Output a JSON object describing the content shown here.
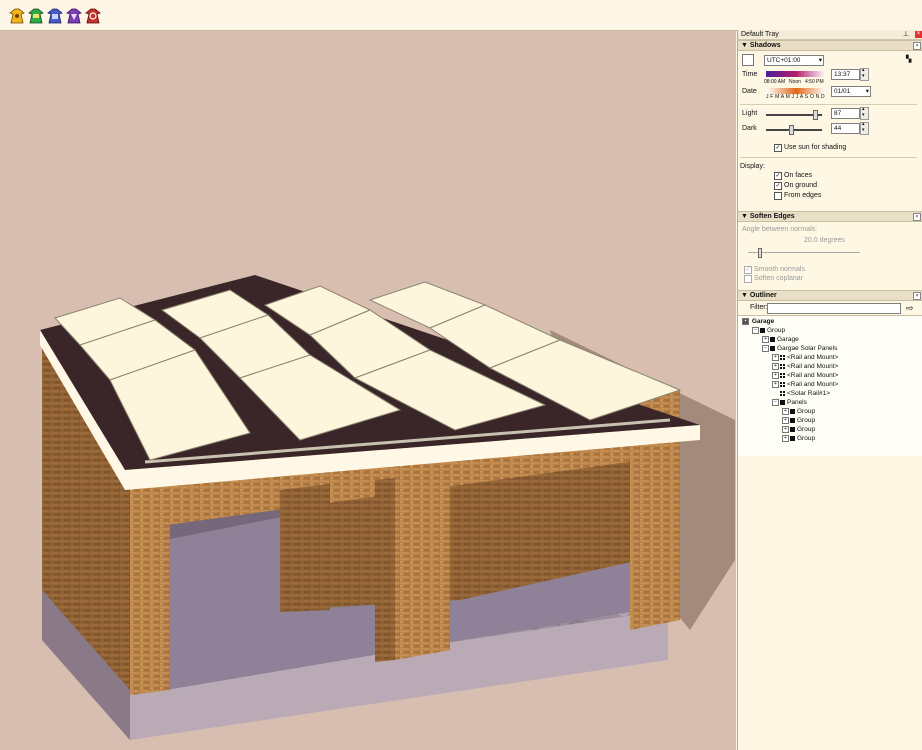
{
  "toolbar": {
    "tools": [
      {
        "name": "styles-icon",
        "color": "#f1b51c"
      },
      {
        "name": "layers-icon",
        "color": "#2ea84a"
      },
      {
        "name": "components-icon",
        "color": "#4a5bc8"
      },
      {
        "name": "materials-icon",
        "color": "#7b3fb4"
      },
      {
        "name": "scenes-icon",
        "color": "#c4302b"
      }
    ]
  },
  "tray": {
    "title": "Default Tray",
    "shadows": {
      "header": "Shadows",
      "timezone": "UTC+01:00",
      "time_label": "Time",
      "time_scale_left": "08:00 AM",
      "time_scale_mid": "Noon",
      "time_scale_right": "4:50 PM",
      "time_value": "13:37",
      "date_label": "Date",
      "months": "J F M A M J J A S O N D",
      "date_value": "01/01",
      "light_label": "Light",
      "light_value": "87",
      "light_level": 0.87,
      "dark_label": "Dark",
      "dark_value": "44",
      "dark_level": 0.44,
      "use_sun_label": "Use sun for shading",
      "display_label": "Display:",
      "on_faces_label": "On faces",
      "on_ground_label": "On ground",
      "from_edges_label": "From edges",
      "use_sun": true,
      "on_faces": true,
      "on_ground": true,
      "from_edges": false
    },
    "soften": {
      "header": "Soften Edges",
      "angle_label": "Angle between normals:",
      "angle_value": "20.0  degrees",
      "smooth_label": "Smooth normals",
      "coplanar_label": "Soften coplanar",
      "angle_level": 0.11
    },
    "outliner": {
      "header": "Outliner",
      "filter_label": "Filter:",
      "filter_value": "",
      "root": "Garage",
      "items": [
        {
          "label": "Group",
          "depth": 1,
          "expander": "−",
          "icon": "sq"
        },
        {
          "label": "Garage",
          "depth": 2,
          "expander": "+",
          "icon": "sq"
        },
        {
          "label": "Gargae Solar Panels",
          "depth": 2,
          "expander": "−",
          "icon": "sq"
        },
        {
          "label": "<Rail and Mount>",
          "depth": 3,
          "expander": "+",
          "icon": "grid"
        },
        {
          "label": "<Rail and Mount>",
          "depth": 3,
          "expander": "+",
          "icon": "grid"
        },
        {
          "label": "<Rail and Mount>",
          "depth": 3,
          "expander": "+",
          "icon": "grid"
        },
        {
          "label": "<Rail and Mount>",
          "depth": 3,
          "expander": "+",
          "icon": "grid"
        },
        {
          "label": "<Solar Rail#1>",
          "depth": 3,
          "expander": "",
          "icon": "grid"
        },
        {
          "label": "Panels",
          "depth": 3,
          "expander": "−",
          "icon": "sq"
        },
        {
          "label": "Group",
          "depth": 4,
          "expander": "+",
          "icon": "sq"
        },
        {
          "label": "Group",
          "depth": 4,
          "expander": "+",
          "icon": "sq"
        },
        {
          "label": "Group",
          "depth": 4,
          "expander": "+",
          "icon": "sq"
        },
        {
          "label": "Group",
          "depth": 4,
          "expander": "+",
          "icon": "sq"
        }
      ]
    }
  }
}
